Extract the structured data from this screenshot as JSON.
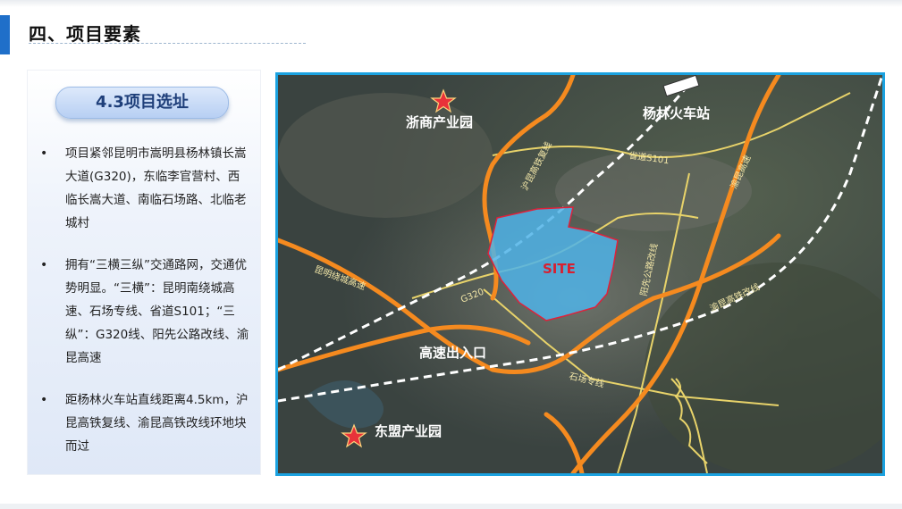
{
  "header": {
    "title": "四、项目要素"
  },
  "sidebar": {
    "section_title": "4.3项目选址",
    "bullets": [
      "项目紧邻昆明市嵩明县杨林镇长嵩大道(G320)，东临李官营村、西临长嵩大道、南临石场路、北临老城村",
      "拥有“三横三纵”交通路网，交通优势明显。“三横”：昆明南绕城高速、石场专线、省道S101；“三纵”：G320线、阳先公路改线、渝昆高速",
      "距杨林火车站直线距离4.5km，沪昆高铁复线、渝昆高铁改线环地块而过"
    ]
  },
  "map": {
    "site_label": "SITE",
    "places": {
      "zheshang": "浙商产业园",
      "yanglin_station": "杨林火车站",
      "highway_exit": "高速出入口",
      "dongmeng": "东盟产业园"
    },
    "roads": {
      "hukun_rail": "沪昆高铁复线",
      "s101": "省道S101",
      "yukun_highway": "渝昆高速",
      "ring_highway": "昆明绕城高速",
      "g320": "G320",
      "yangxian_road": "阳先公路改线",
      "yukun_rail": "渝昆高铁改线",
      "shichang_line": "石场专线"
    },
    "colors": {
      "site_fill": "#4fb3e8",
      "site_border": "#e0203a",
      "highway": "#f58a1f",
      "road": "#e8d36a",
      "rail": "#ffffff",
      "frame": "#1ba2e0"
    }
  }
}
